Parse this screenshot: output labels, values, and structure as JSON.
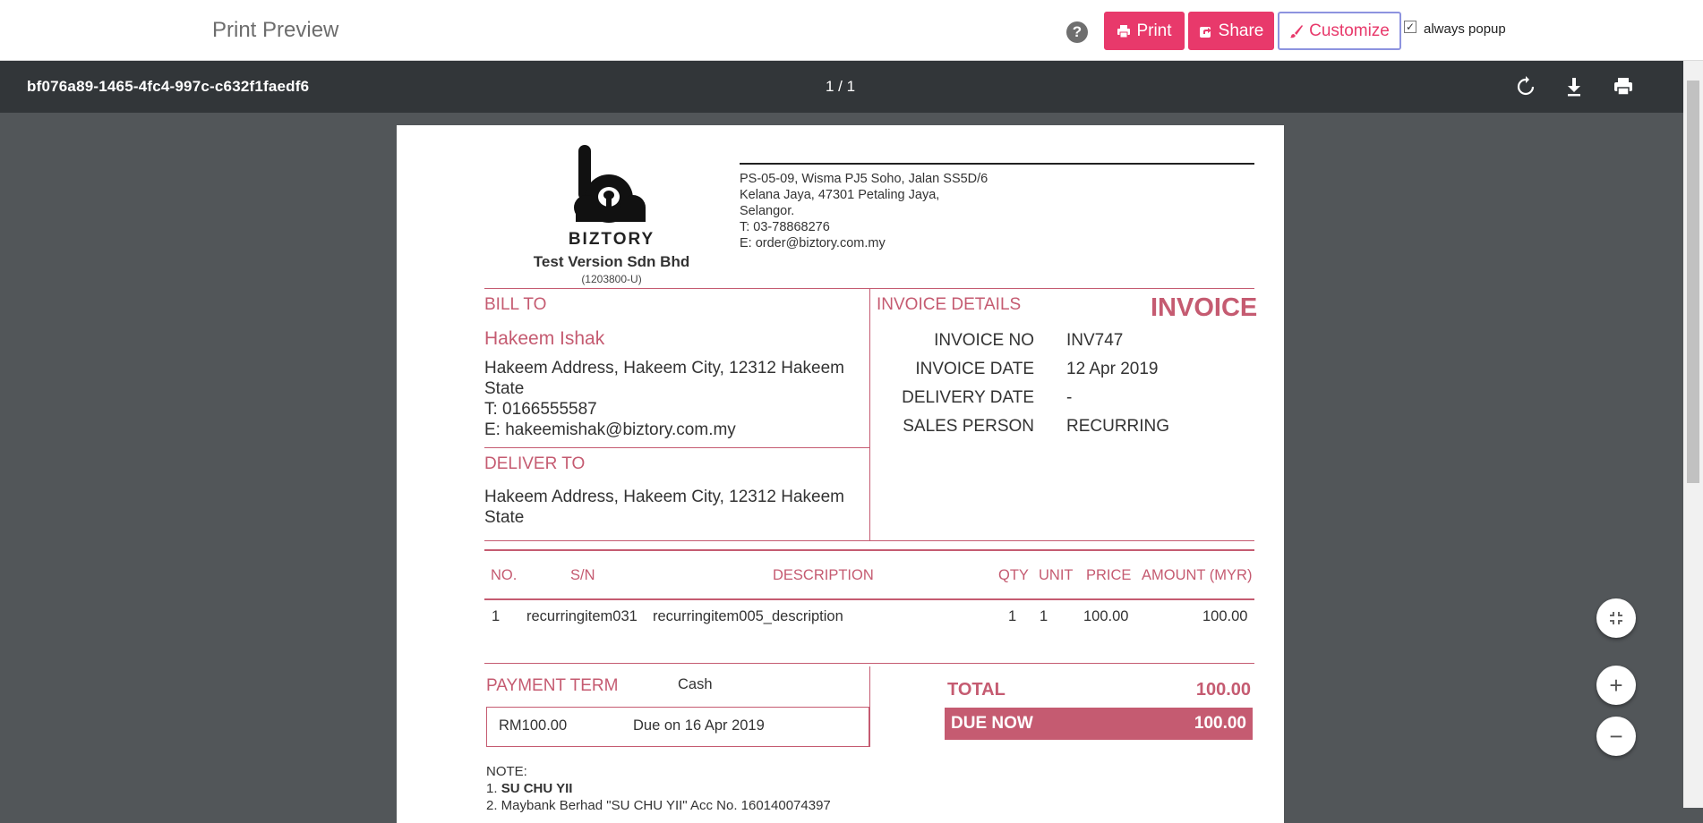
{
  "header": {
    "title": "Print Preview",
    "print_label": "Print",
    "share_label": "Share",
    "customize_label": "Customize",
    "always_popup_label": "always popup"
  },
  "viewer": {
    "file_name": "bf076a89-1465-4fc4-997c-c632f1faedf6",
    "page_indicator": "1 / 1"
  },
  "invoice": {
    "brand": "BIZTORY",
    "company": "Test Version Sdn Bhd",
    "reg_no": "(1203800-U)",
    "address": [
      "PS-05-09, Wisma PJ5 Soho, Jalan SS5D/6",
      "Kelana Jaya, 47301 Petaling Jaya,",
      "Selangor.",
      "T: 03-78868276",
      "E: order@biztory.com.my"
    ],
    "bill_to": {
      "heading": "BILL TO",
      "name": "Hakeem Ishak",
      "address_line1": "Hakeem Address, Hakeem City, 12312 Hakeem",
      "address_line2": "State",
      "phone": "T: 0166555587",
      "email": "E: hakeemishak@biztory.com.my"
    },
    "deliver_to": {
      "heading": "DELIVER TO",
      "address_line1": "Hakeem Address, Hakeem City, 12312 Hakeem",
      "address_line2": "State"
    },
    "details": {
      "heading": "INVOICE DETAILS",
      "doc_type": "INVOICE",
      "fields": [
        {
          "label": "INVOICE NO",
          "value": "INV747"
        },
        {
          "label": "INVOICE DATE",
          "value": "12 Apr 2019"
        },
        {
          "label": "DELIVERY DATE",
          "value": "-"
        },
        {
          "label": "SALES PERSON",
          "value": "RECURRING"
        }
      ]
    },
    "table": {
      "columns": [
        "NO.",
        "S/N",
        "DESCRIPTION",
        "QTY",
        "UNIT",
        "PRICE",
        "AMOUNT (MYR)"
      ],
      "rows": [
        [
          "1",
          "recurringitem031",
          "recurringitem005_description",
          "1",
          "1",
          "100.00",
          "100.00"
        ]
      ]
    },
    "payment": {
      "heading": "PAYMENT TERM",
      "term": "Cash",
      "amount": "RM100.00",
      "due": "Due on 16 Apr 2019"
    },
    "totals": {
      "total_label": "TOTAL",
      "total_value": "100.00",
      "due_label": "DUE NOW",
      "due_value": "100.00"
    },
    "note": {
      "heading": "NOTE:",
      "line1_prefix": "1. ",
      "line1": "SU CHU YII",
      "line2": "2. Maybank Berhad \"SU CHU YII\" Acc No. 160140074397"
    }
  },
  "colors": {
    "accent": "#e8396b",
    "invoice_pink": "#c55b71",
    "viewer_bg": "#525659",
    "viewer_toolbar": "#323639"
  },
  "icons": {
    "help": "question-circle-icon",
    "print": "printer-icon",
    "share": "share-icon",
    "customize": "paintbrush-icon",
    "rotate": "rotate-icon",
    "download": "download-icon",
    "viewer_print": "printer-icon",
    "fit": "fit-page-icon",
    "zoom_in": "plus-icon",
    "zoom_out": "minus-icon"
  }
}
